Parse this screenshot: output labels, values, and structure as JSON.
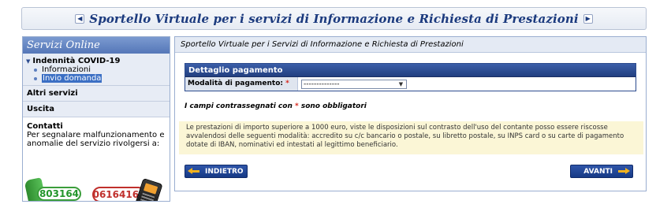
{
  "banner": {
    "title": "Sportello Virtuale per i servizi di Informazione e Richiesta di Prestazioni",
    "prev_icon": "chevron-left-icon",
    "next_icon": "chevron-right-icon"
  },
  "sidebar": {
    "header": "Servizi Online",
    "section": {
      "title": "Indennità COVID-19",
      "items": [
        {
          "label": "Informazioni",
          "selected": false
        },
        {
          "label": "Invio domanda",
          "selected": true
        }
      ]
    },
    "links": [
      "Altri servizi",
      "Uscita"
    ],
    "contacts": {
      "title": "Contatti",
      "text": "Per segnalare malfunzionamento e anomalie del servizio rivolgersi a:",
      "phone_fixed": "803164",
      "phone_mobile": "06164164"
    }
  },
  "main": {
    "header": "Sportello Virtuale per i Servizi di Informazione e Richiesta di Prestazioni",
    "detail": {
      "title": "Dettaglio pagamento",
      "field_label": "Modalità di pagamento:",
      "required_mark": "*",
      "select_value": "--------------"
    },
    "note_prefix": "I campi contrassegnati con",
    "note_mark": "*",
    "note_suffix": "sono obbligatori",
    "info": "Le prestazioni di importo superiore a 1000 euro, viste le disposizioni sul contrasto dell'uso del contante posso essere riscosse avvalendosi delle seguenti modalità: accredito su c/c bancario o postale, su libretto postale, su INPS card o su carte di pagamento dotate di IBAN, nominativi ed intestati al legittimo beneficiario.",
    "back_label": "INDIETRO",
    "next_label": "AVANTI"
  },
  "colors": {
    "accent": "#1b3a7e",
    "button": "#163a86",
    "required": "#d8261c",
    "info_bg": "#fbf6d6"
  }
}
